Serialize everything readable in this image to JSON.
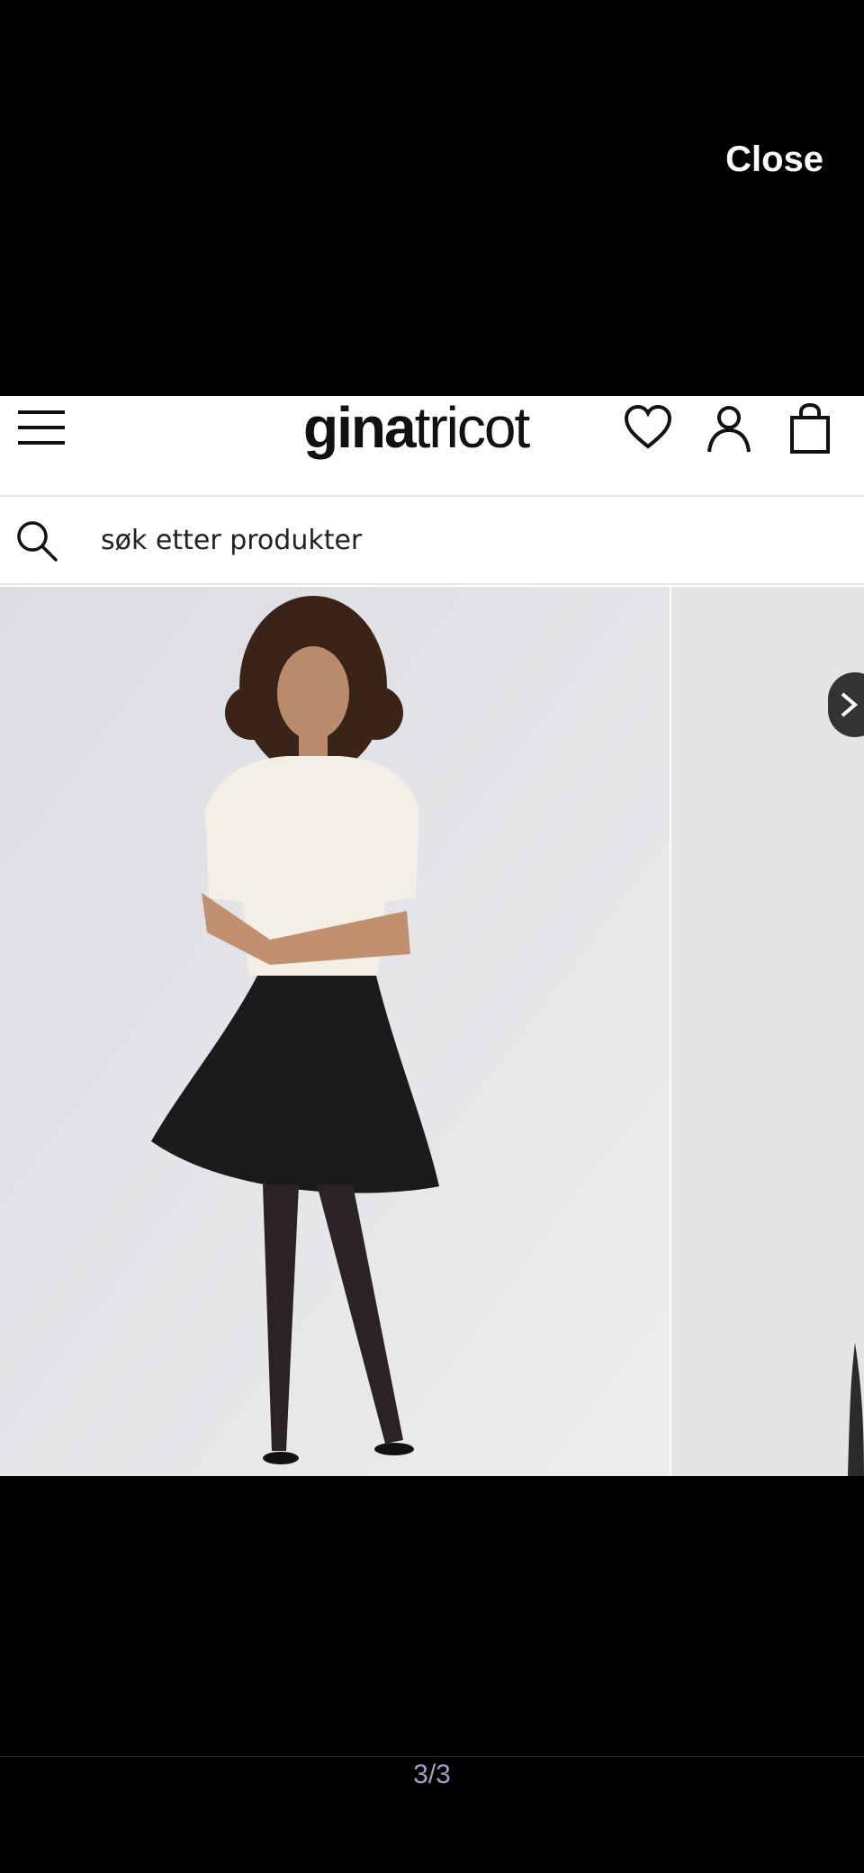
{
  "overlay": {
    "close_label": "Close"
  },
  "site": {
    "logo_bold": "gina",
    "logo_light": "tricot",
    "icons": [
      "menu-icon",
      "heart-icon",
      "user-icon",
      "bag-icon"
    ]
  },
  "search": {
    "placeholder": "søk etter produkter",
    "value": ""
  },
  "gallery": {
    "image_description": "model in cream cable-knit short-sleeve sweater and black skirt",
    "colors": {
      "background": "#000000",
      "photo_bg": "#e6e6e8",
      "skirt": "#1b1b1d",
      "sweater": "#f4efe4"
    }
  },
  "pager": {
    "counter": "3/3"
  }
}
